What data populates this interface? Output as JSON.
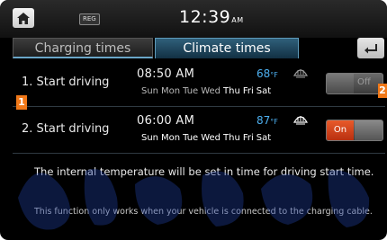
{
  "status_bar": {
    "badge": "REG",
    "clock_time": "12:39",
    "clock_ampm": "AM"
  },
  "tabs": [
    {
      "label": "Charging times",
      "active": false
    },
    {
      "label": "Climate times",
      "active": true
    }
  ],
  "rows": [
    {
      "label": "1. Start driving",
      "time": "08:50 AM",
      "days": [
        "Sun",
        "Mon",
        "Tue",
        "Wed",
        "Thu",
        "Fri",
        "Sat"
      ],
      "temperature": "68",
      "temperature_unit": "°F",
      "switch_label": "Off",
      "enabled": false
    },
    {
      "label": "2. Start driving",
      "time": "06:00 AM",
      "days": [
        "Sun",
        "Mon",
        "Tue",
        "Wed",
        "Thu",
        "Fri",
        "Sat"
      ],
      "temperature": "87",
      "temperature_unit": "°F",
      "switch_label": "On",
      "enabled": true
    }
  ],
  "markers": [
    "1",
    "2"
  ],
  "info": {
    "main": "The internal temperature will be set in time for driving start time.",
    "note": "This function only works when your vehicle is connected to the charging cable."
  },
  "colors": {
    "temperature": "#4db0f0",
    "switch_on": "#e85a2a",
    "marker": "#f07818",
    "tab_active": "#2f5f7a"
  },
  "icons": {
    "home": "home-icon",
    "back": "back-icon",
    "defrost": "defrost-icon"
  }
}
